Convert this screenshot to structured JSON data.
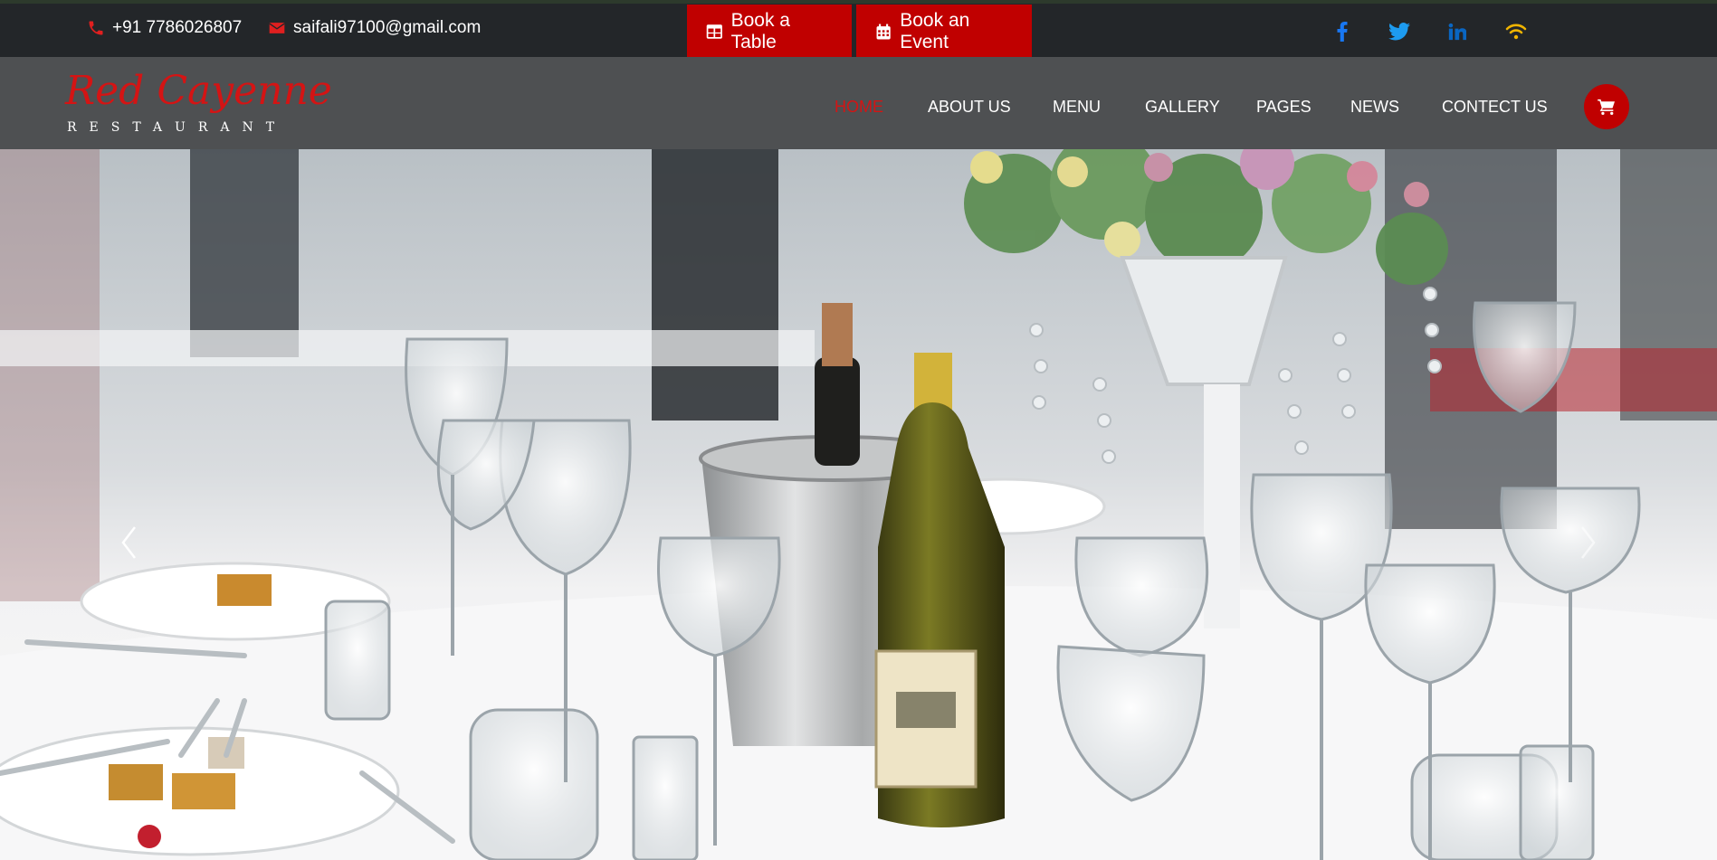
{
  "topbar": {
    "phone": "+91 7786026807",
    "email": "saifali97100@gmail.com",
    "book_table_label": "Book a Table",
    "book_event_label": "Book an Event",
    "social": [
      "facebook-icon",
      "twitter-icon",
      "linkedin-icon",
      "rss-icon"
    ]
  },
  "brand": {
    "name": "Red Cayenne",
    "tagline": "RESTAURANT"
  },
  "nav": {
    "items": [
      {
        "label": "HOME",
        "active": true
      },
      {
        "label": "ABOUT US",
        "active": false
      },
      {
        "label": "MENU",
        "active": false
      },
      {
        "label": "GALLERY",
        "active": false
      },
      {
        "label": "PAGES",
        "active": false
      },
      {
        "label": "NEWS",
        "active": false
      },
      {
        "label": "CONTECT US",
        "active": false
      }
    ],
    "cart_icon": "cart-icon"
  },
  "hero": {
    "image": "restaurant-table-setting",
    "prev_icon": "chevron-left-icon",
    "next_icon": "chevron-right-icon"
  },
  "colors": {
    "accent": "#c00000",
    "active_nav": "#d41414",
    "topbar_bg": "#232629",
    "navbar_bg": "#4e5052",
    "facebook": "#1877f2",
    "twitter": "#1d9bf0",
    "linkedin": "#0a66c2",
    "rss": "#f0b400"
  }
}
